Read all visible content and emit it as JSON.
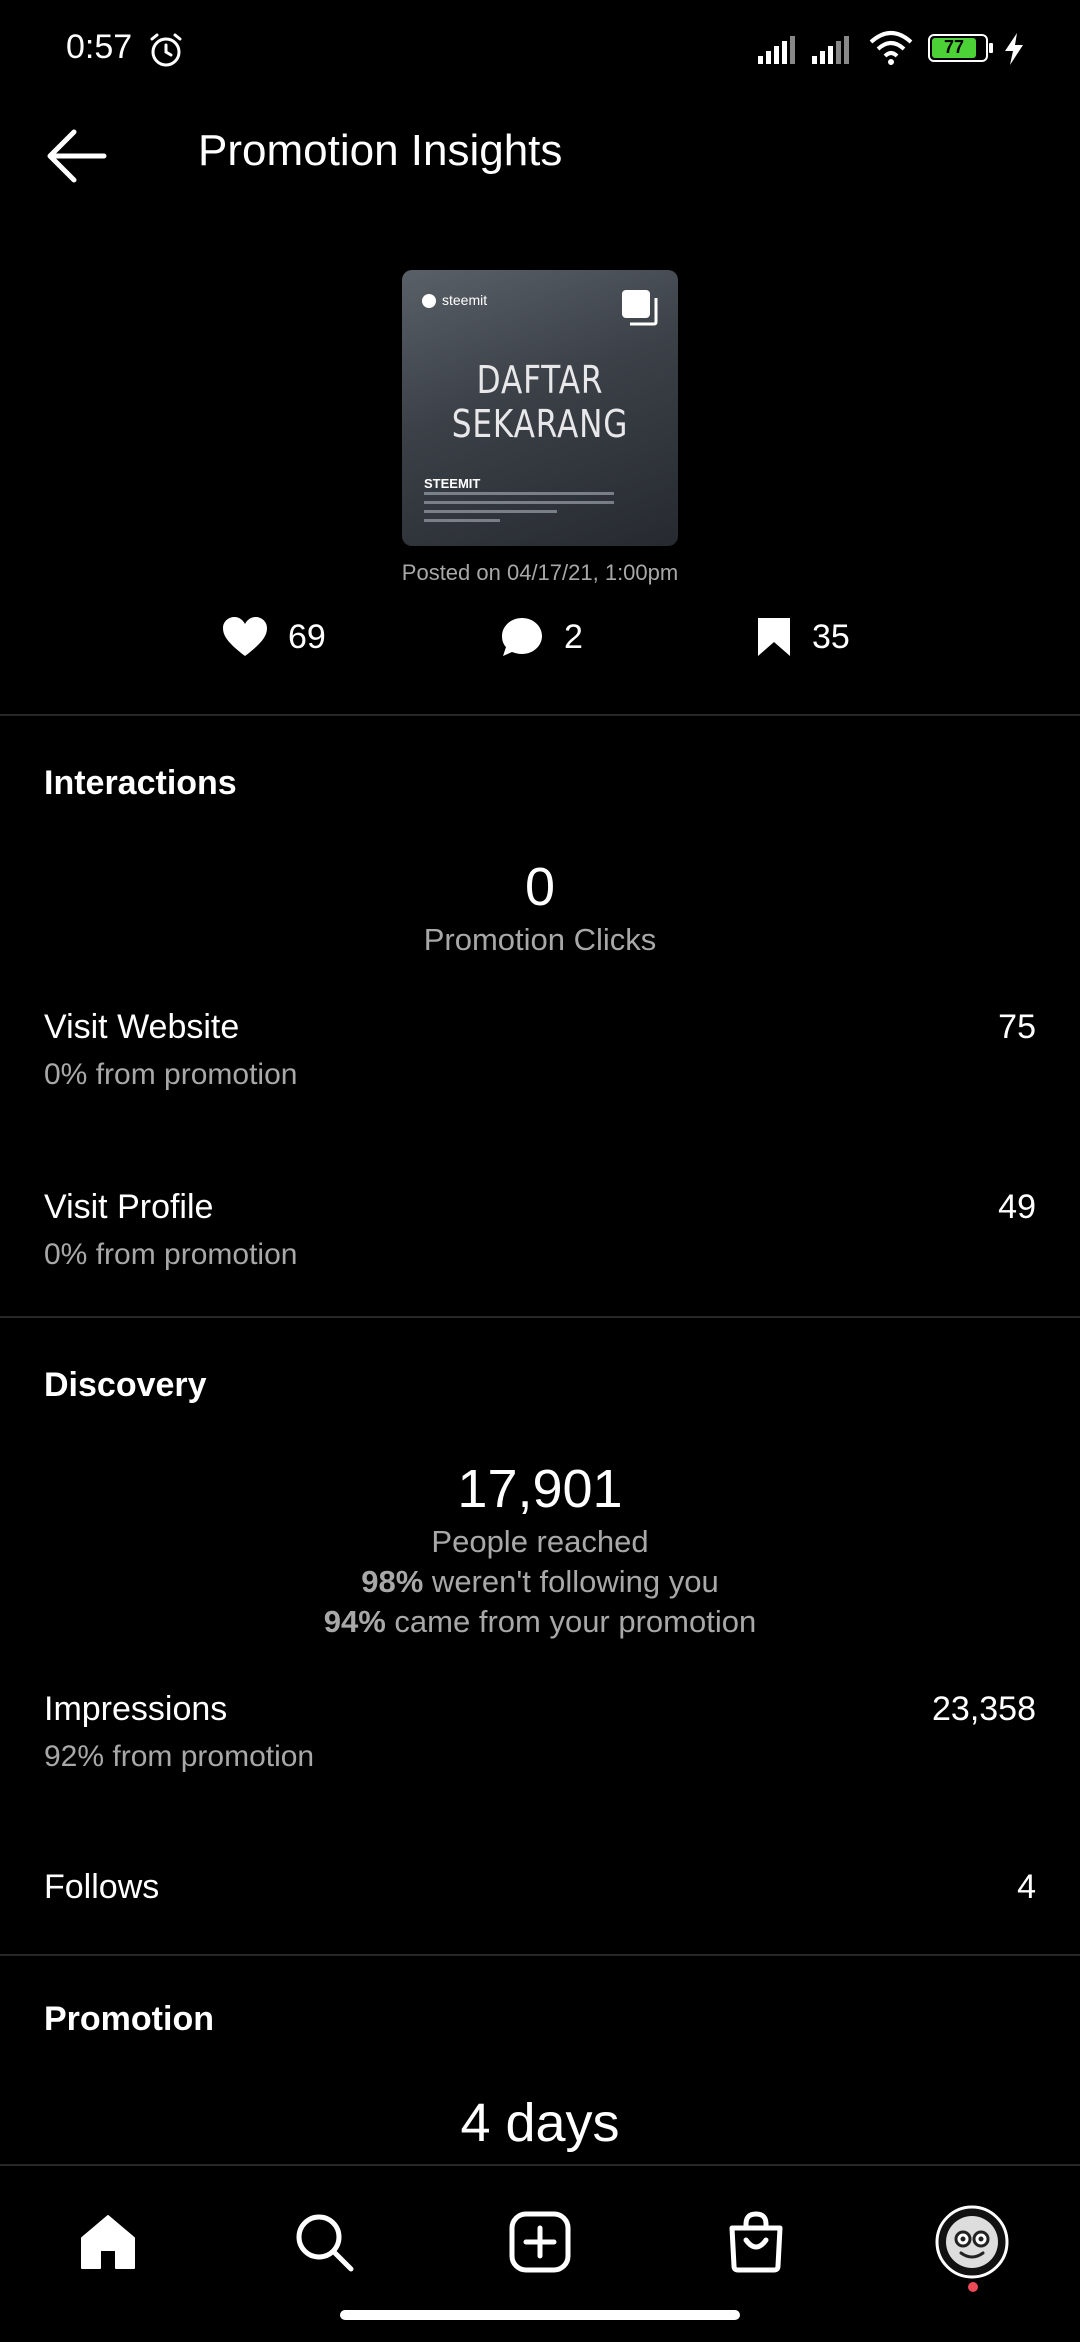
{
  "status_bar": {
    "time": "0:57",
    "battery_level": "77",
    "icons": [
      "alarm-icon",
      "signal-icon",
      "signal-icon",
      "wifi-icon",
      "battery-icon",
      "charging-icon"
    ],
    "battery_color": "#4cd137"
  },
  "header": {
    "title": "Promotion Insights",
    "back_icon": "arrow-left-icon"
  },
  "post": {
    "thumbnail_brand": "steemit",
    "thumbnail_headline_1": "DAFTAR",
    "thumbnail_headline_2": "SEKARANG",
    "thumbnail_subtitle": "STEEMIT",
    "posted_on": "Posted on 04/17/21, 1:00pm",
    "likes": "69",
    "comments": "2",
    "saves": "35"
  },
  "interactions": {
    "title": "Interactions",
    "promotion_clicks_value": "0",
    "promotion_clicks_label": "Promotion Clicks",
    "visit_website_label": "Visit Website",
    "visit_website_sub": "0% from promotion",
    "visit_website_value": "75",
    "visit_profile_label": "Visit Profile",
    "visit_profile_sub": "0% from promotion",
    "visit_profile_value": "49"
  },
  "discovery": {
    "title": "Discovery",
    "people_reached_value": "17,901",
    "people_reached_label": "People reached",
    "not_following_pct": "98%",
    "not_following_text": " weren't following you",
    "from_promotion_pct": "94%",
    "from_promotion_text": " came from your promotion",
    "impressions_label": "Impressions",
    "impressions_sub": "92% from promotion",
    "impressions_value": "23,358",
    "follows_label": "Follows",
    "follows_value": "4"
  },
  "promotion": {
    "title": "Promotion",
    "duration": "4 days"
  },
  "bottom_nav": {
    "items": [
      "home-icon",
      "search-icon",
      "create-icon",
      "shop-icon",
      "profile-avatar"
    ],
    "notification_color": "#ed4956"
  }
}
